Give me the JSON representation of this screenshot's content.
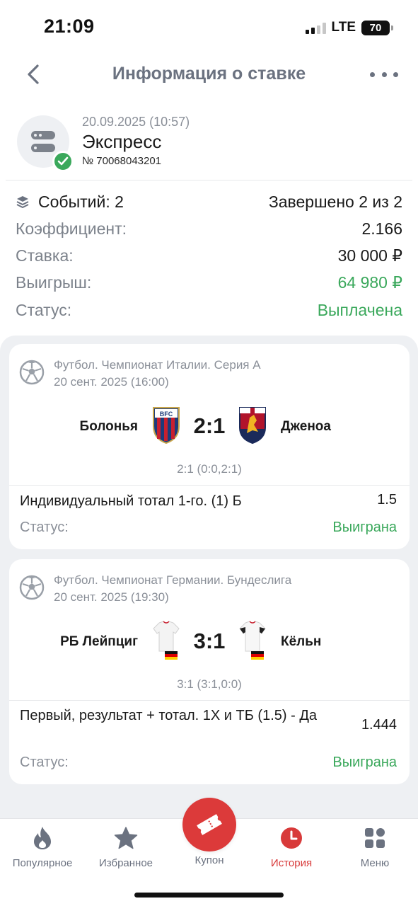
{
  "status_bar": {
    "time": "21:09",
    "network": "LTE",
    "battery": "70"
  },
  "nav": {
    "title": "Информация о ставке"
  },
  "bet": {
    "date": "20.09.2025 (10:57)",
    "type": "Экспресс",
    "number": "№ 70068043201"
  },
  "summary": {
    "events_label": "Событий: 2",
    "completed": "Завершено 2 из 2",
    "coef_label": "Коэффициент:",
    "coef_value": "2.166",
    "stake_label": "Ставка:",
    "stake_value": "30 000 ₽",
    "win_label": "Выигрыш:",
    "win_value": "64 980 ₽",
    "status_label": "Статус:",
    "status_value": "Выплачена"
  },
  "events": [
    {
      "league": "Футбол. Чемпионат Италии. Серия А",
      "date": "20 сент. 2025 (16:00)",
      "home": "Болонья",
      "away": "Дженоа",
      "score": "2:1",
      "subscore": "2:1 (0:0,2:1)",
      "market": "Индивидуальный тотал 1-го. (1) Б",
      "odds": "1.5",
      "status_label": "Статус:",
      "status_value": "Выиграна"
    },
    {
      "league": "Футбол. Чемпионат Германии. Бундеслига",
      "date": "20 сент. 2025 (19:30)",
      "home": "РБ Лейпциг",
      "away": "Кёльн",
      "score": "3:1",
      "subscore": "3:1 (3:1,0:0)",
      "market": "Первый, результат + тотал. 1Х и ТБ (1.5) - Да",
      "odds": "1.444",
      "status_label": "Статус:",
      "status_value": "Выиграна"
    }
  ],
  "tabs": [
    {
      "label": "Популярное",
      "icon": "flame-icon"
    },
    {
      "label": "Избранное",
      "icon": "star-icon"
    },
    {
      "label": "Купон",
      "icon": "ticket-icon"
    },
    {
      "label": "История",
      "icon": "clock-icon",
      "active": true
    },
    {
      "label": "Меню",
      "icon": "grid-icon"
    }
  ],
  "colors": {
    "accent": "#dc3a3a",
    "green": "#3aa85b",
    "muted": "#8a8f98"
  }
}
